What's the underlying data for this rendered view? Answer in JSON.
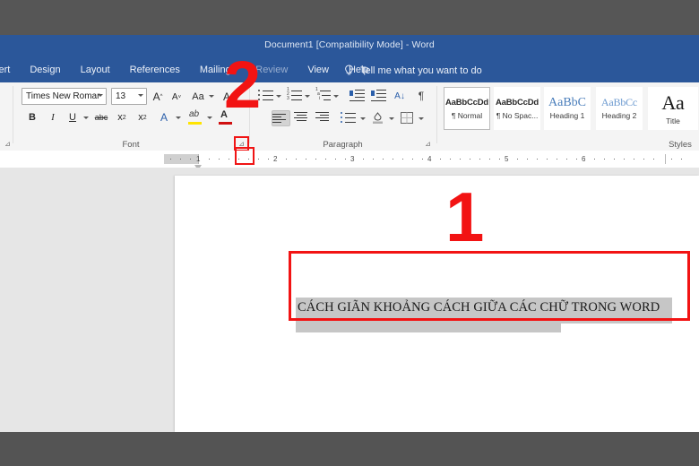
{
  "window": {
    "title": "Document1 [Compatibility Mode]  -  Word",
    "titlebar_color": "#2b579a"
  },
  "ribbon": {
    "tabs": [
      {
        "label": "sert",
        "name": "tab-insert"
      },
      {
        "label": "Design",
        "name": "tab-design"
      },
      {
        "label": "Layout",
        "name": "tab-layout"
      },
      {
        "label": "References",
        "name": "tab-references"
      },
      {
        "label": "Mailings",
        "name": "tab-mailings"
      },
      {
        "label": "Review",
        "name": "tab-review"
      },
      {
        "label": "View",
        "name": "tab-view"
      },
      {
        "label": "Help",
        "name": "tab-help"
      }
    ],
    "tell_me": "Tell me what you want to do",
    "groups": {
      "font": {
        "label": "Font",
        "font_name": "Times New Romar",
        "font_size": "13",
        "grow_font": "A",
        "shrink_font": "A",
        "change_case": "Aa",
        "clear_formatting": "A",
        "bold": "B",
        "italic": "I",
        "underline": "U",
        "strikethrough": "abc",
        "subscript": "x",
        "superscript": "x",
        "text_effects": "A",
        "highlight": "ab",
        "font_color": "A",
        "launcher": "⊿"
      },
      "paragraph": {
        "label": "Paragraph",
        "launcher": "⊿",
        "sort": "A↓",
        "marks": "¶"
      },
      "styles": {
        "label": "Styles",
        "items": [
          {
            "preview": "AaBbCcDd",
            "name": "¶ Normal",
            "selected": true
          },
          {
            "preview": "AaBbCcDd",
            "name": "¶ No Spac...",
            "selected": false
          },
          {
            "preview": "AaBbC",
            "name": "Heading 1",
            "selected": false
          },
          {
            "preview": "AaBbCc",
            "name": "Heading 2",
            "selected": false
          },
          {
            "preview": "Aa",
            "name": "Title",
            "selected": false
          }
        ]
      }
    }
  },
  "ruler": {
    "numbers": [
      "1",
      "2",
      "3",
      "4",
      "5",
      "6"
    ]
  },
  "document": {
    "text": "CÁCH GIÃN KHOẢNG CÁCH GIỮA CÁC CHỮ TRONG WORD",
    "selection_color": "#c6c6c6"
  },
  "annotations": {
    "step_one": "1",
    "step_two": "2",
    "highlight_color": "#f21313"
  }
}
